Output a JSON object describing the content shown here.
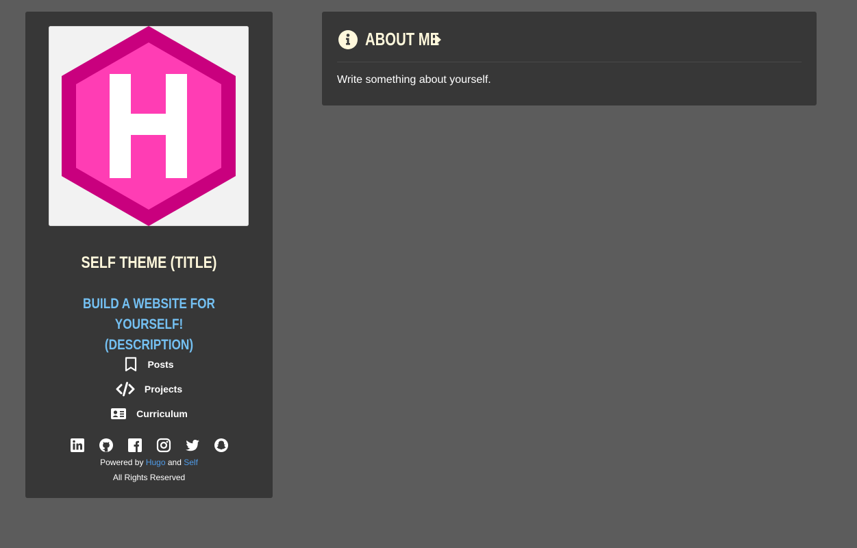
{
  "sidebar": {
    "logo_letter": "H",
    "title": "SELF THEME (TITLE)",
    "description_line1": "BUILD A WEBSITE FOR YOURSELF!",
    "description_line2": "(DESCRIPTION)",
    "nav": [
      {
        "label": "Posts",
        "icon": "bookmark-icon"
      },
      {
        "label": "Projects",
        "icon": "code-icon"
      },
      {
        "label": "Curriculum",
        "icon": "id-card-icon"
      }
    ],
    "social": [
      "linkedin-icon",
      "github-icon",
      "facebook-icon",
      "instagram-icon",
      "twitter-icon",
      "snapchat-icon"
    ],
    "footer": {
      "powered_by": "Powered by",
      "hugo": "Hugo",
      "and": "and",
      "self": "Self",
      "rights": "All Rights Reserved"
    }
  },
  "about": {
    "title": "ABOUT ME",
    "body": "Write something about yourself."
  },
  "colors": {
    "background": "#5c5c5c",
    "panel": "#373737",
    "title": "#fff8dc",
    "description": "#74c0f2",
    "link": "#4f9be8",
    "logo_dark": "#c9007e",
    "logo_light": "#ff3db4"
  }
}
